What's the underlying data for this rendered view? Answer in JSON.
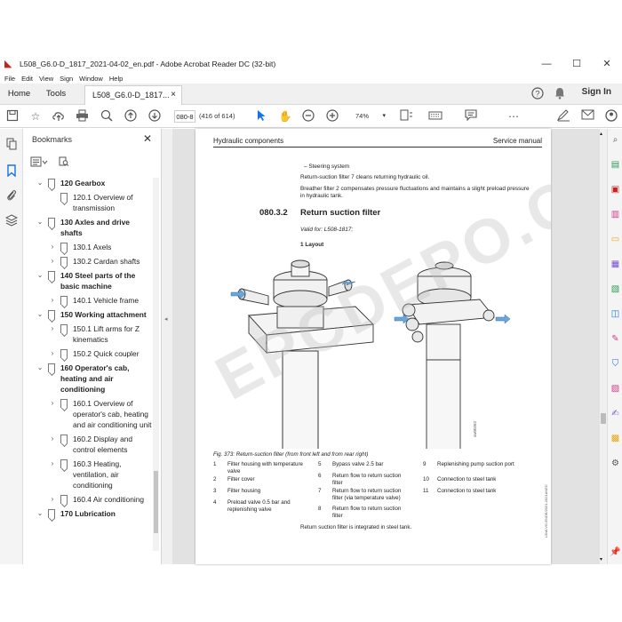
{
  "window": {
    "title": "L508_G6.0-D_1817_2021-04-02_en.pdf - Adobe Acrobat Reader DC (32-bit)",
    "minimize": "—",
    "maximize": "☐",
    "close": "✕"
  },
  "menu": [
    "File",
    "Edit",
    "View",
    "Sign",
    "Window",
    "Help"
  ],
  "tabs": {
    "home": "Home",
    "tools": "Tools",
    "document": "L508_G6.0-D_1817...",
    "doc_close": "×",
    "sign_in": "Sign In"
  },
  "toolbar": {
    "page_value": "080-8",
    "page_count": "(416 of 614)",
    "zoom": "74%"
  },
  "bookmarks": {
    "title": "Bookmarks",
    "close": "✕",
    "items": [
      {
        "level": 0,
        "expanded": true,
        "label": "120 Gearbox"
      },
      {
        "level": 1,
        "expanded": null,
        "label": "120.1 Overview of transmission"
      },
      {
        "level": 0,
        "expanded": true,
        "label": "130 Axles and drive shafts"
      },
      {
        "level": 1,
        "expanded": false,
        "label": "130.1 Axels"
      },
      {
        "level": 1,
        "expanded": false,
        "label": "130.2 Cardan shafts"
      },
      {
        "level": 0,
        "expanded": true,
        "label": "140 Steel parts of the basic machine"
      },
      {
        "level": 1,
        "expanded": false,
        "label": "140.1 Vehicle frame"
      },
      {
        "level": 0,
        "expanded": true,
        "label": "150 Working attachment"
      },
      {
        "level": 1,
        "expanded": false,
        "label": "150.1 Lift arms for Z kinematics"
      },
      {
        "level": 1,
        "expanded": false,
        "label": "150.2 Quick coupler"
      },
      {
        "level": 0,
        "expanded": true,
        "label": "160 Operator's cab, heating and air conditioning"
      },
      {
        "level": 1,
        "expanded": false,
        "label": "160.1 Overview of operator's cab, heating and air conditioning unit"
      },
      {
        "level": 1,
        "expanded": false,
        "label": "160.2 Display and control elements"
      },
      {
        "level": 1,
        "expanded": false,
        "label": "160.3 Heating, ventilation, air conditioning"
      },
      {
        "level": 1,
        "expanded": false,
        "label": "160.4 Air conditioning"
      },
      {
        "level": 0,
        "expanded": true,
        "label": "170 Lubrication"
      }
    ]
  },
  "document": {
    "header_left": "Hydraulic components",
    "header_right": "Service manual",
    "bullet": "–   Steering system",
    "para1": "Return-suction filter 7 cleans returning hydraulic oil.",
    "para2": "Breather filter 2 compensates pressure fluctuations and maintains a slight preload pressure in hydraulic tank.",
    "section_number": "080.3.2",
    "section_title": "Return suction filter",
    "valid_for": "Valid for: L508-1817;",
    "layout_heading": "1 Layout",
    "figure_caption": "Fig. 373: Return-suction filter (from front left and from rear right)",
    "figure_id": "sw00262",
    "legend": [
      {
        "n": "1",
        "t": "Filter housing with temperature valve"
      },
      {
        "n": "2",
        "t": "Filter cover"
      },
      {
        "n": "3",
        "t": "Filter housing"
      },
      {
        "n": "4",
        "t": "Preload valve 0.5 bar and replenishing valve"
      },
      {
        "n": "5",
        "t": "Bypass valve 2.5 bar"
      },
      {
        "n": "6",
        "t": "Return flow to return suction filter"
      },
      {
        "n": "7",
        "t": "Return flow to return suction filter (via temperature valve)"
      },
      {
        "n": "8",
        "t": "Return flow to return suction filter"
      },
      {
        "n": "9",
        "t": "Replenishing pump suction port"
      },
      {
        "n": "10",
        "t": "Connection to steel tank"
      },
      {
        "n": "11",
        "t": "Connection to steel tank"
      }
    ],
    "bottom_note": "Return suction filter is integrated in steel tank.",
    "side_id": "L5h8-VG-ENDE/2021-2021ANEC",
    "watermark": "EPCDEPO.COM"
  }
}
